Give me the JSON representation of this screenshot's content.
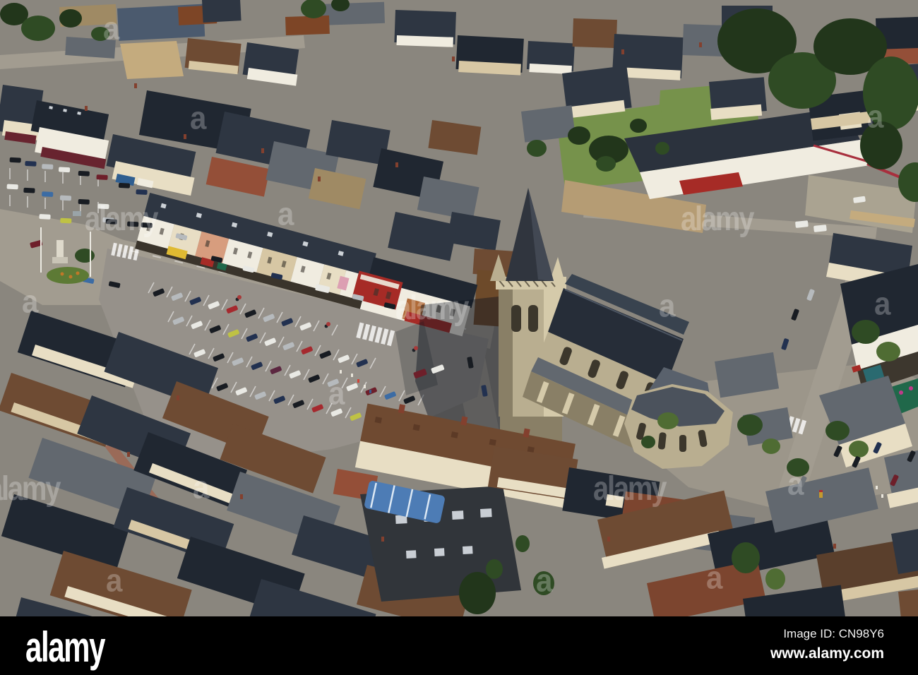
{
  "image": {
    "alt": "Aerial view of a French town centre: Gothic church with slate spire, market square car park full of cars, shop rows with awnings and dense slate and brown rooftops",
    "agency": "alamy"
  },
  "watermark": {
    "brand": "alamy",
    "tile": "a"
  },
  "footer": {
    "brand": "alamy",
    "image_id": "Image ID: CN98Y6",
    "website": "www.alamy.com"
  },
  "colors": {
    "asphalt": "#8a867e",
    "road": "#a29c90",
    "square": "#96918a",
    "cobble": "#9c968a",
    "pave_new": "#aaa391",
    "dirt": "#b59c74",
    "sand": "#c4ab7e",
    "lane_red": "#9a6a58",
    "lawn": "#76924b",
    "slate": "#2e3642",
    "slate_dark": "#202731",
    "slate_light": "#4b5a6e",
    "slate_weath": "#62686f",
    "roof_brown": "#6e4b33",
    "roof_rust": "#7d4526",
    "roof_tile": "#7c452f",
    "roof_tan": "#9f8a64",
    "plank": "#6d4a2a",
    "wall_cream": "#e8dec4",
    "wall_white": "#f0ece0",
    "wall_beige": "#d7c7a4",
    "wall_salmon": "#d79d7e",
    "brick": "#944f38",
    "stone": "#b9ae90",
    "stone_light": "#d5caaa",
    "stone_dark": "#897f66",
    "spire": "#30353e",
    "tree": "#2f4b24",
    "tree_dark": "#22361b",
    "tree_light": "#4f6c33",
    "shadow": "rgba(14,20,30,0.45)",
    "line": "rgba(255,255,255,0.78)",
    "awning_red": "#a62b26",
    "awning_yellow": "#dfba32",
    "awning_pink": "#dc9fb2",
    "awning_maroon": "#68242f",
    "shop_green": "#20684a",
    "shop_teal": "#2a6a70",
    "shop_blue": "#2f5e90",
    "fence_red": "#a82f3d",
    "canopy": "#4d7cb5",
    "hall_roof": "#31353a",
    "theater_roof": "#2b323d",
    "wm": "rgba(255,255,255,0.26)",
    "footer_bg": "#000000",
    "footer_fg": "#ffffff",
    "car_black": "#181c22",
    "car_white": "#e9e9e4",
    "car_silver": "#b6babd",
    "car_dkblue": "#223150",
    "car_blue": "#3c6ca4",
    "car_red": "#a5292e",
    "car_dkred": "#6e1f2a",
    "car_lime": "#bfc244",
    "car_maroon": "#5c2740",
    "car_gray": "#70757a"
  }
}
